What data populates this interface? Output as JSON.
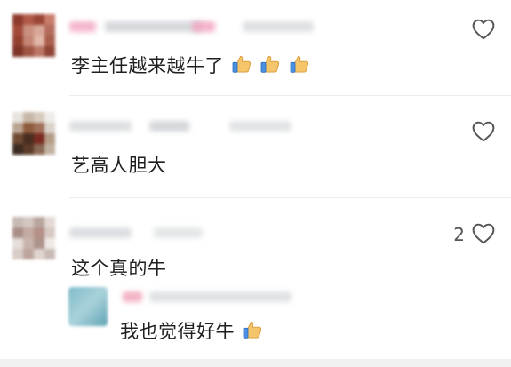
{
  "comments": [
    {
      "text": "李主任越来越牛了",
      "thumbs": 3,
      "like_count": ""
    },
    {
      "text": "艺高人胆大",
      "thumbs": 0,
      "like_count": ""
    },
    {
      "text": "这个真的牛",
      "thumbs": 0,
      "like_count": "2",
      "reply": {
        "text": "我也觉得好牛",
        "thumbs": 1
      }
    }
  ],
  "colors": {
    "text": "#1f1f1f",
    "divider": "#ececec",
    "icon": "#555555"
  },
  "icons": {
    "like": "heart-outline-icon",
    "emoji": "thumbs-up-icon"
  }
}
